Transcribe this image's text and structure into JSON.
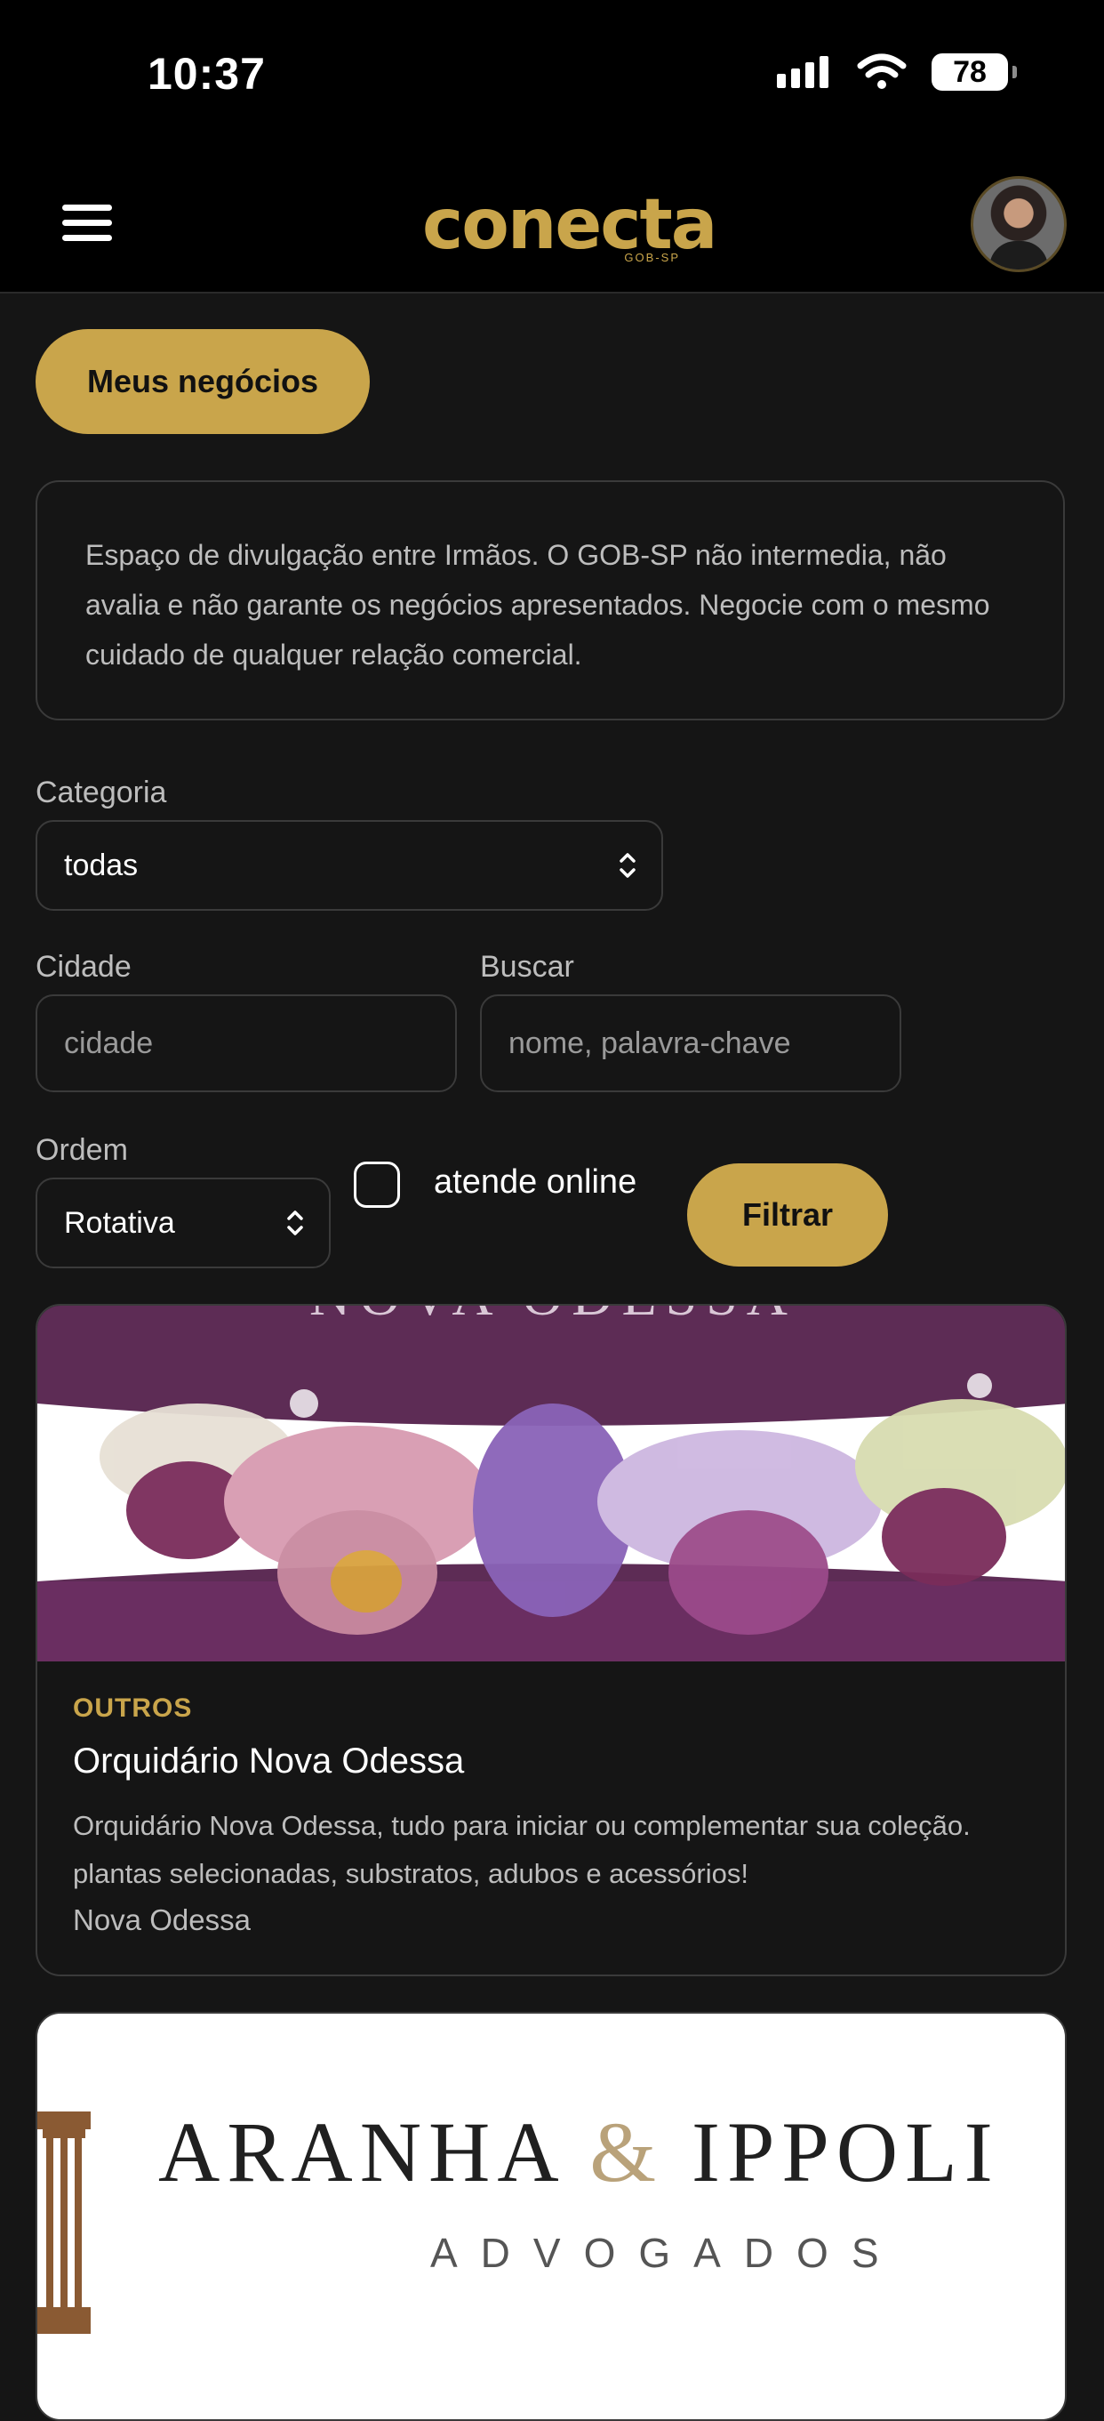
{
  "status_bar": {
    "time": "10:37",
    "battery": "78"
  },
  "header": {
    "logo_text": "conecta",
    "logo_sub": "GOB-SP",
    "menu_icon": "hamburger-icon",
    "avatar": "user-avatar"
  },
  "actions": {
    "meus_negocios": "Meus negócios"
  },
  "notice": "Espaço de divulgação entre Irmãos. O GOB-SP não intermedia, não avalia e não garante os negócios apresentados. Negocie com o mesmo cuidado de qualquer relação comercial.",
  "filters": {
    "categoria": {
      "label": "Categoria",
      "value": "todas"
    },
    "cidade": {
      "label": "Cidade",
      "placeholder": "cidade"
    },
    "buscar": {
      "label": "Buscar",
      "placeholder": "nome, palavra-chave"
    },
    "ordem": {
      "label": "Ordem",
      "value": "Rotativa"
    },
    "online_label": "atende online",
    "filter_button": "Filtrar"
  },
  "listings": [
    {
      "banner_text": "NOVA ODESSA",
      "category": "OUTROS",
      "title": "Orquidário Nova Odessa",
      "description": "Orquidário Nova Odessa, tudo para iniciar ou complementar sua coleção. plantas selecionadas, substratos, adubos e acessórios!",
      "city": "Nova Odessa"
    },
    {
      "banner_main_1": "ARANHA ",
      "banner_amp": "&",
      "banner_main_2": " IPPOLI",
      "banner_sub": "ADVOGADOS"
    }
  ],
  "colors": {
    "accent": "#c9a54b",
    "background": "#151515",
    "header": "#000000"
  }
}
